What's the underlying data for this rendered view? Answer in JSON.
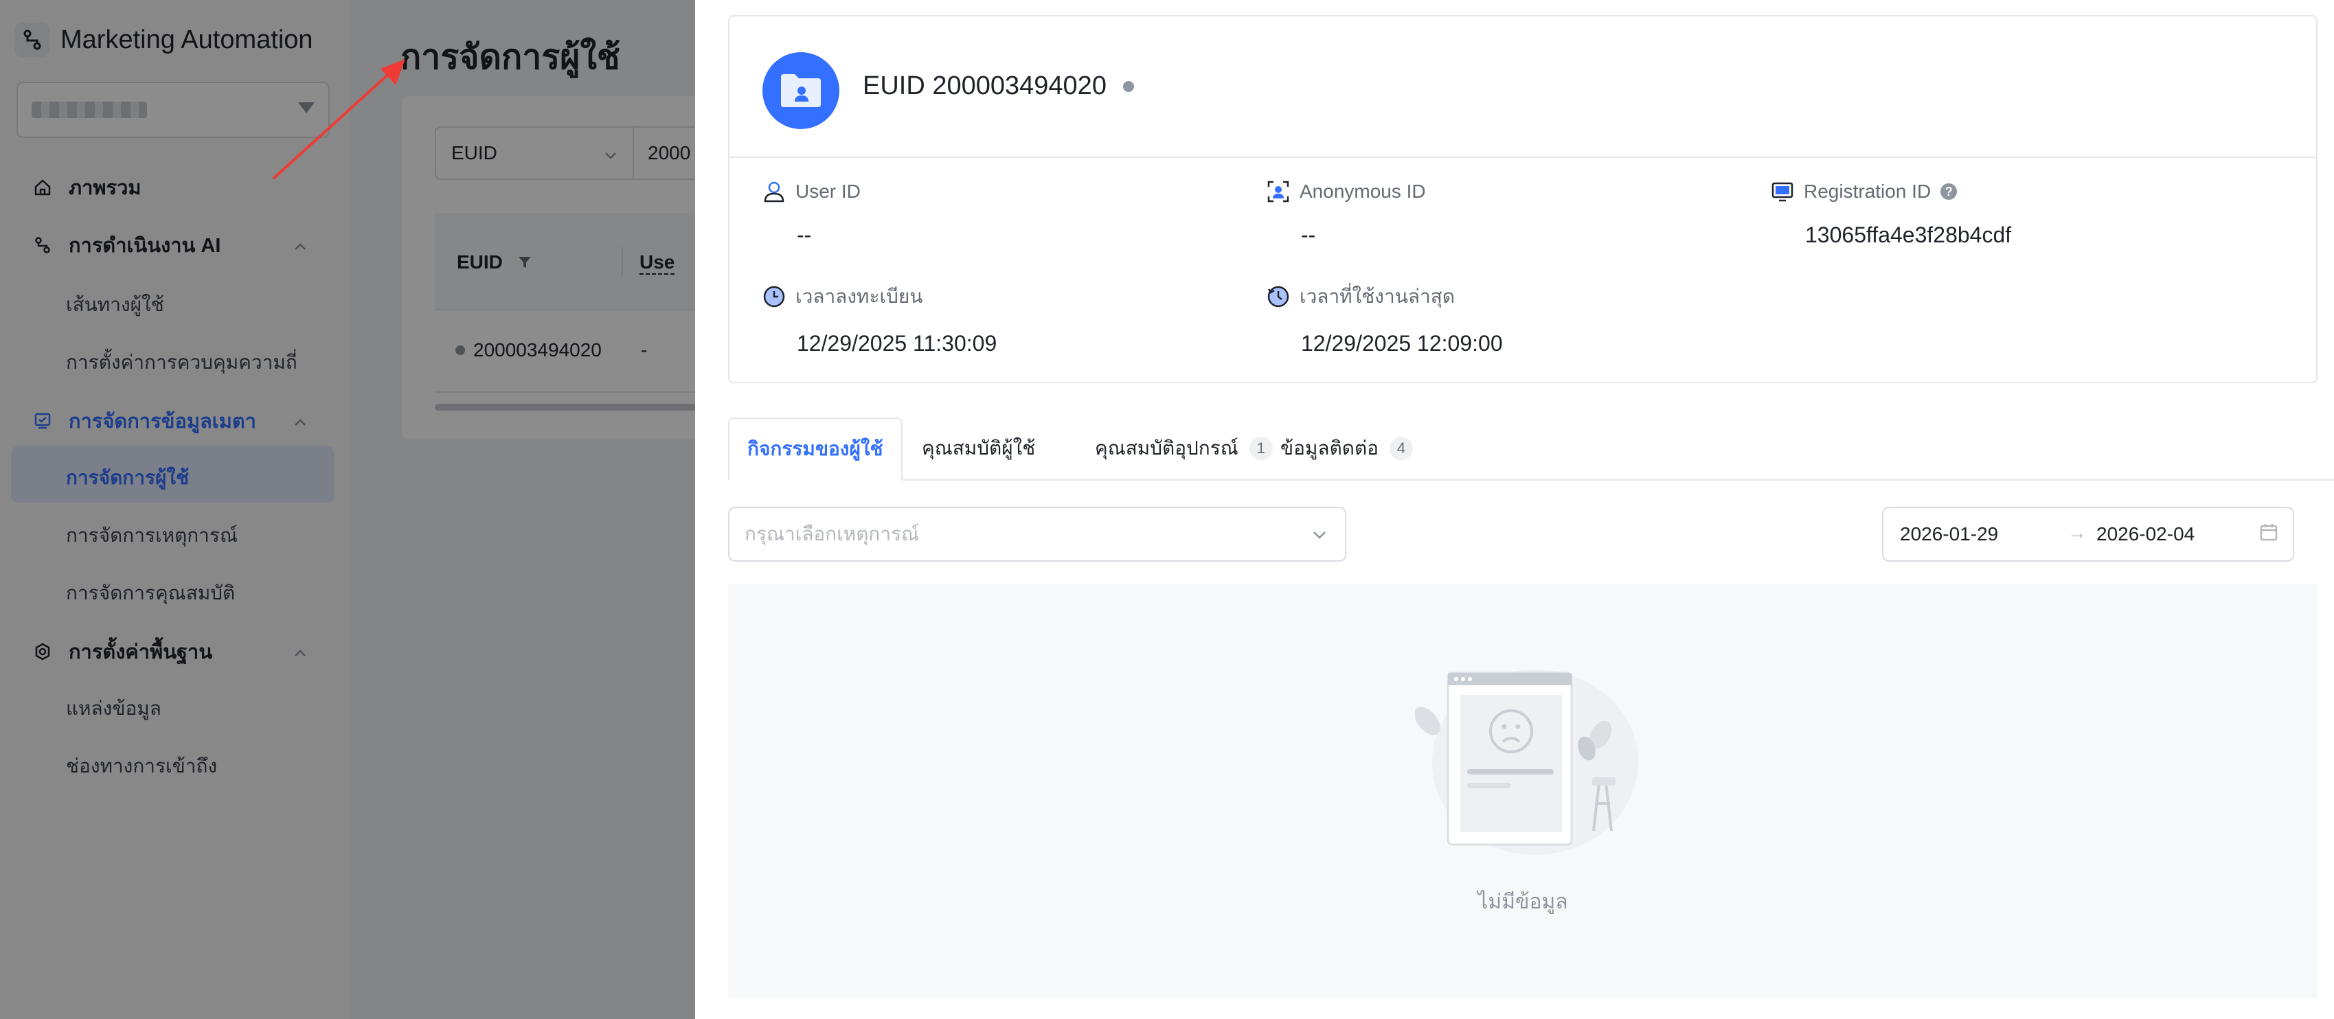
{
  "app": {
    "title": "Marketing Automation"
  },
  "sidebar": {
    "items": [
      {
        "label": "ภาพรวม"
      },
      {
        "label": "การดำเนินงาน AI",
        "children": [
          "เส้นทางผู้ใช้",
          "การตั้งค่าการควบคุมความถี่"
        ]
      },
      {
        "label": "การจัดการข้อมูลเมตา",
        "children": [
          "การจัดการผู้ใช้",
          "การจัดการเหตุการณ์",
          "การจัดการคุณสมบัติ"
        ]
      },
      {
        "label": "การตั้งค่าพื้นฐาน",
        "children": [
          "แหล่งข้อมูล",
          "ช่องทางการเข้าถึง"
        ]
      }
    ]
  },
  "main": {
    "page_title": "การจัดการผู้ใช้",
    "filter": {
      "field": "EUID",
      "value": "2000"
    },
    "table": {
      "columns": [
        "EUID",
        "Use"
      ],
      "rows": [
        {
          "euid": "200003494020",
          "user": "-"
        }
      ]
    }
  },
  "drawer": {
    "profile": {
      "name": "EUID 200003494020",
      "fields": {
        "user_id": {
          "label": "User ID",
          "value": "--"
        },
        "anonymous_id": {
          "label": "Anonymous ID",
          "value": "--"
        },
        "registration_id": {
          "label": "Registration ID",
          "value": "13065ffa4e3f28b4cdf"
        },
        "register_time": {
          "label": "เวลาลงทะเบียน",
          "value": "12/29/2025 11:30:09"
        },
        "last_active": {
          "label": "เวลาที่ใช้งานล่าสุด",
          "value": "12/29/2025 12:09:00"
        }
      }
    },
    "tabs": [
      {
        "label": "กิจกรรมของผู้ใช้",
        "active": true
      },
      {
        "label": "คุณสมบัติผู้ใช้"
      },
      {
        "label": "คุณสมบัติอุปกรณ์",
        "count": "1"
      },
      {
        "label": "ข้อมูลติดต่อ",
        "count": "4"
      }
    ],
    "event_select": {
      "placeholder": "กรุณาเลือกเหตุการณ์"
    },
    "date_range": {
      "start": "2026-01-29",
      "end": "2026-02-04",
      "arrow": "→"
    },
    "empty_text": "ไม่มีข้อมูล"
  },
  "colors": {
    "primary": "#3370ff",
    "annotation": "#ee3b36",
    "mask": "rgba(0,0,0,0.45)"
  }
}
